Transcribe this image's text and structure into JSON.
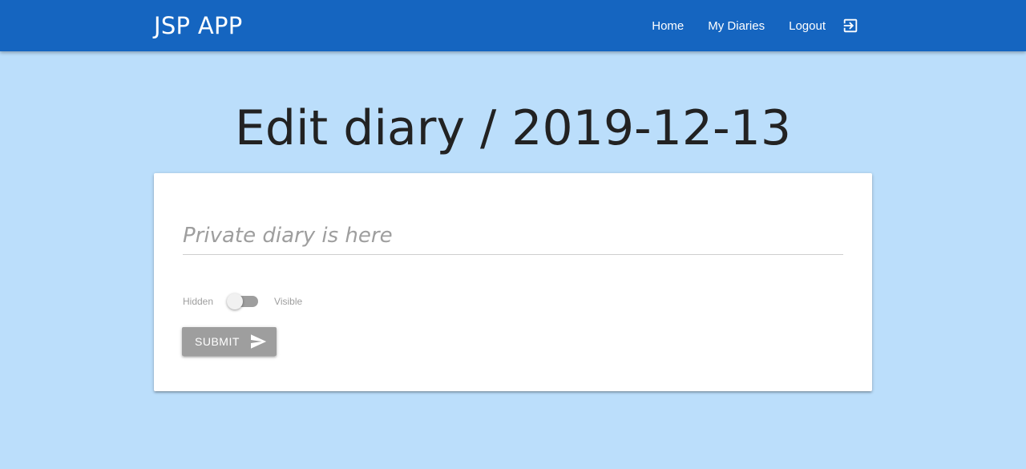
{
  "navbar": {
    "brand": "JSP APP",
    "links": [
      {
        "label": "Home"
      },
      {
        "label": "My Diaries"
      },
      {
        "label": "Logout",
        "icon": "logout-icon"
      }
    ],
    "background_color": "#1565c0"
  },
  "page": {
    "title": "Edit diary / 2019-12-13",
    "background_color": "#bbdefb"
  },
  "form": {
    "diary_input": {
      "placeholder": "Private diary is here",
      "value": ""
    },
    "visibility_switch": {
      "off_label": "Hidden",
      "on_label": "Visible",
      "checked": false
    },
    "submit_button": {
      "label": "SUBMIT",
      "icon": "send-icon",
      "color": "#9e9e9e"
    }
  }
}
